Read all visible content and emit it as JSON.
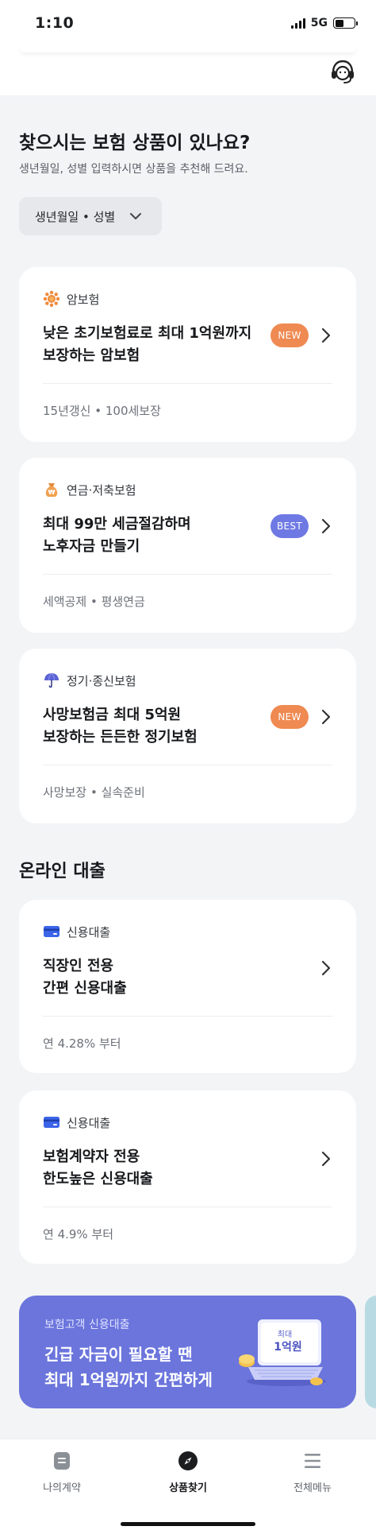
{
  "status_bar": {
    "time": "1:10",
    "network": "5G"
  },
  "insurance_section": {
    "title": "찾으시는 보험 상품이 있나요?",
    "subtitle": "생년월일, 성별 입력하시면 상품을 추천해 드려요.",
    "filter_label": "생년월일 • 성별"
  },
  "insurance_cards": [
    {
      "category": "암보험",
      "icon": "sun-flower-icon",
      "title_line1": "낮은 초기보험료로 최대 1억원까지",
      "title_line2": "보장하는 암보험",
      "badge": "NEW",
      "footer": "15년갱신 • 100세보장"
    },
    {
      "category": "연금·저축보험",
      "icon": "money-pouch-icon",
      "title_line1": "최대 99만 세금절감하며",
      "title_line2": "노후자금 만들기",
      "badge": "BEST",
      "footer": "세액공제 • 평생연금"
    },
    {
      "category": "정기·종신보험",
      "icon": "umbrella-icon",
      "title_line1": "사망보험금 최대 5억원",
      "title_line2": "보장하는 든든한 정기보험",
      "badge": "NEW",
      "footer": "사망보장 • 실속준비"
    }
  ],
  "loan_section": {
    "title": "온라인 대출"
  },
  "loan_cards": [
    {
      "category": "신용대출",
      "icon": "credit-card-icon",
      "title_line1": "직장인 전용",
      "title_line2": "간편 신용대출",
      "footer": "연 4.28% 부터"
    },
    {
      "category": "신용대출",
      "icon": "credit-card-icon",
      "title_line1": "보험계약자 전용",
      "title_line2": "한도높은 신용대출",
      "footer": "연 4.9% 부터"
    }
  ],
  "banner": {
    "kicker": "보험고객 신용대출",
    "line1": "긴급 자금이 필요할 땐",
    "line2": "최대 1억원까지 간편하게",
    "tag_small": "최대",
    "tag_big": "1억원"
  },
  "tabbar": {
    "items": [
      {
        "label": "나의계약",
        "icon": "document-icon",
        "active": false
      },
      {
        "label": "상품찾기",
        "icon": "compass-icon",
        "active": true
      },
      {
        "label": "전체메뉴",
        "icon": "hamburger-menu-icon",
        "active": false
      }
    ]
  },
  "colors": {
    "background": "#f3f4f6",
    "card": "#ffffff",
    "badge_new": "#ef8a52",
    "badge_best": "#6f79e3",
    "banner": "#6b75dc",
    "text_primary": "#17191c",
    "text_secondary": "#6c7178"
  }
}
